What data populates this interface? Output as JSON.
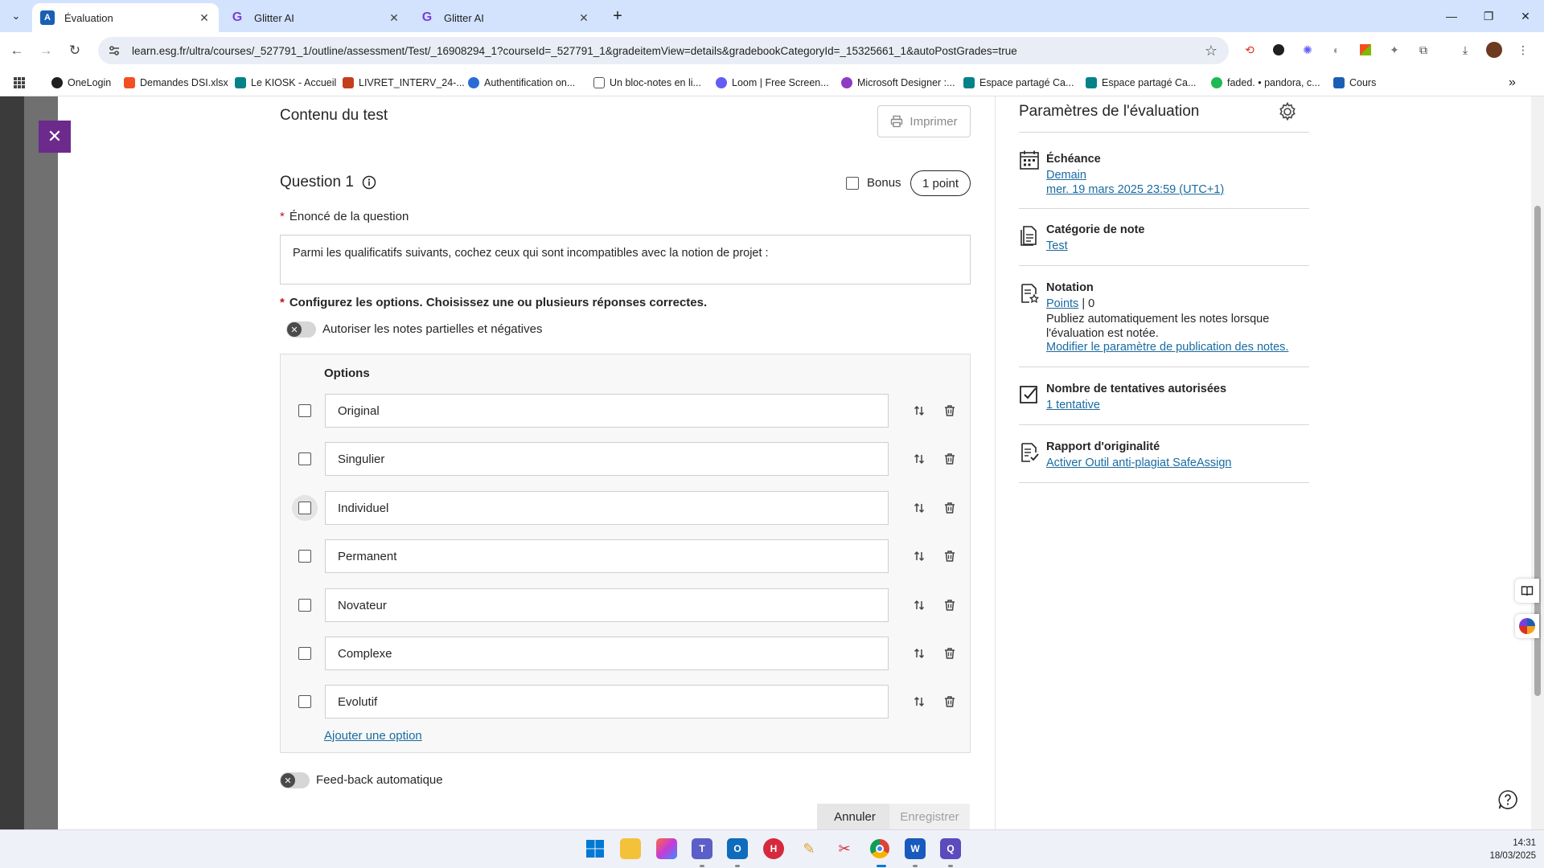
{
  "browser": {
    "tabs": [
      {
        "title": "Évaluation",
        "active": true
      },
      {
        "title": "Glitter AI",
        "active": false
      },
      {
        "title": "Glitter AI",
        "active": false
      }
    ],
    "url": "learn.esg.fr/ultra/courses/_527791_1/outline/assessment/Test/_16908294_1?courseId=_527791_1&gradeitemView=details&gradebookCategoryId=_15325661_1&autoPostGrades=true",
    "bookmarks": [
      {
        "label": "OneLogin",
        "color": "#1f1f1f"
      },
      {
        "label": "Demandes DSI.xlsx",
        "color": "#f25022"
      },
      {
        "label": "Le KIOSK - Accueil",
        "color": "#038387"
      },
      {
        "label": "LIVRET_INTERV_24-...",
        "color": "#c43e1c"
      },
      {
        "label": "Authentification on...",
        "color": "#2b6cd4"
      },
      {
        "label": "Un bloc-notes en li...",
        "color": "#555555"
      },
      {
        "label": "Loom | Free Screen...",
        "color": "#625df5"
      },
      {
        "label": "Microsoft Designer :...",
        "color": "#8e3cc4"
      },
      {
        "label": "Espace partagé Ca...",
        "color": "#038387"
      },
      {
        "label": "Espace partagé Ca...",
        "color": "#038387"
      },
      {
        "label": "faded. • pandora, c...",
        "color": "#1db954"
      },
      {
        "label": "Cours",
        "color": "#1a5fb4"
      }
    ]
  },
  "content": {
    "section_title": "Contenu du test",
    "print_label": "Imprimer",
    "question_title": "Question 1",
    "bonus_label": "Bonus",
    "points_label": "1 point",
    "statement_label": "Énoncé de la question",
    "statement_text": "Parmi les qualificatifs suivants, cochez ceux qui sont incompatibles avec la notion de projet :",
    "configure_label": "Configurez les options. Choisissez une ou plusieurs réponses correctes.",
    "partial_toggle_label": "Autoriser les notes partielles et négatives",
    "options_header": "Options",
    "options": [
      "Original",
      "Singulier",
      "Individuel",
      "Permanent",
      "Novateur",
      "Complexe",
      "Evolutif"
    ],
    "add_option_label": "Ajouter une option",
    "feedback_toggle_label": "Feed-back automatique",
    "cancel_label": "Annuler",
    "save_label": "Enregistrer"
  },
  "settings": {
    "title": "Paramètres de l'évaluation",
    "due": {
      "head": "Échéance",
      "link1": "Demain",
      "link2": "mer. 19 mars 2025 23:59 (UTC+1)"
    },
    "category": {
      "head": "Catégorie de note",
      "link": "Test"
    },
    "grading": {
      "head": "Notation",
      "link": "Points",
      "value": "| 0",
      "text": "Publiez automatiquement les notes lorsque l'évaluation est notée.",
      "link2": "Modifier le paramètre de publication des notes."
    },
    "attempts": {
      "head": "Nombre de tentatives autorisées",
      "link": "1 tentative"
    },
    "originality": {
      "head": "Rapport d'originalité",
      "link": "Activer Outil anti-plagiat SafeAssign"
    }
  },
  "taskbar": {
    "time": "14:31",
    "date": "18/03/2025"
  }
}
